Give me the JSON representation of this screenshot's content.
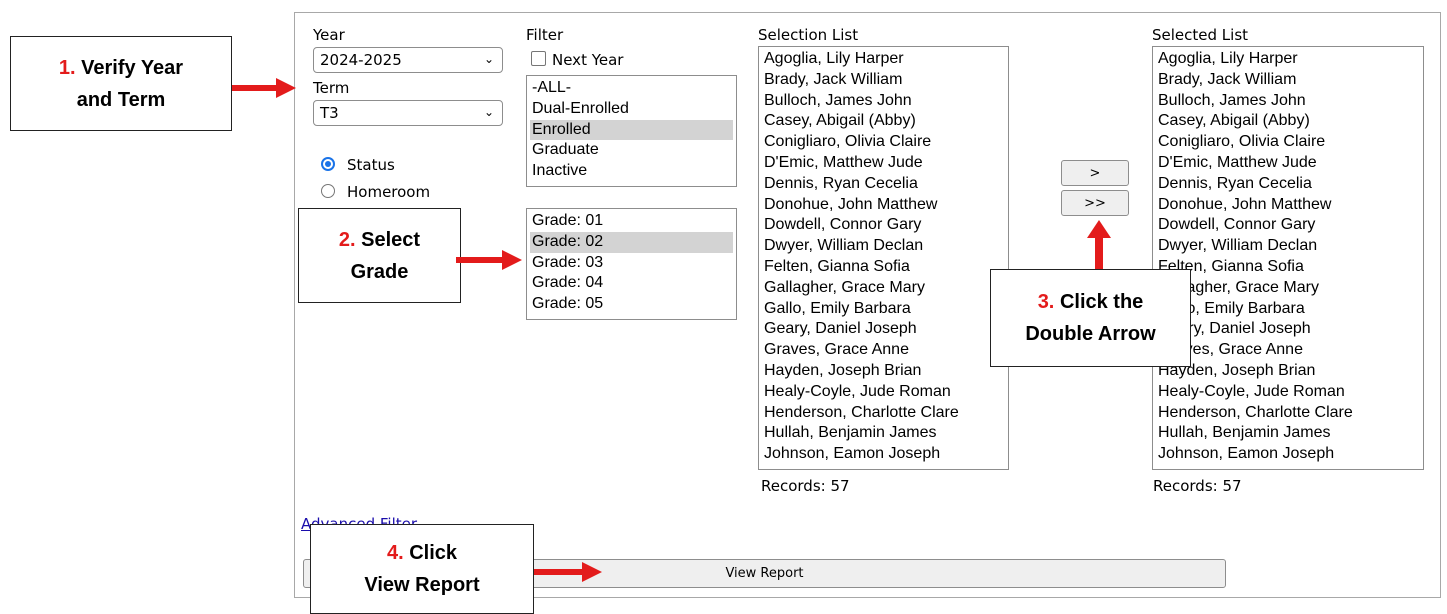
{
  "form": {
    "year_label": "Year",
    "year_value": "2024-2025",
    "term_label": "Term",
    "term_value": "T3",
    "radios": [
      {
        "label": "Status",
        "checked": true
      },
      {
        "label": "Homeroom",
        "checked": false
      }
    ],
    "filter_label": "Filter",
    "next_year_label": "Next Year",
    "status_options": [
      "-ALL-",
      "Dual-Enrolled",
      "Enrolled",
      "Graduate",
      "Inactive"
    ],
    "status_selected": "Enrolled",
    "grade_options": [
      "Grade: 01",
      "Grade: 02",
      "Grade: 03",
      "Grade: 04",
      "Grade: 05"
    ],
    "grade_selected": "Grade: 02",
    "selection_list_label": "Selection List",
    "selected_list_label": "Selected List",
    "students": [
      "Agoglia, Lily Harper",
      "Brady, Jack William",
      "Bulloch, James John",
      "Casey, Abigail (Abby)",
      "Conigliaro, Olivia Claire",
      "D'Emic, Matthew Jude",
      "Dennis, Ryan Cecelia",
      "Donohue, John Matthew",
      "Dowdell, Connor Gary",
      "Dwyer, William Declan",
      "Felten, Gianna Sofia",
      "Gallagher, Grace Mary",
      "Gallo, Emily Barbara",
      "Geary, Daniel Joseph",
      "Graves, Grace Anne",
      "Hayden, Joseph Brian",
      "Healy-Coyle, Jude Roman",
      "Henderson, Charlotte Clare",
      "Hullah, Benjamin James",
      "Johnson, Eamon Joseph"
    ],
    "selection_records": "Records: 57",
    "selected_records": "Records: 57",
    "move_one_label": ">",
    "move_all_label": ">>",
    "advanced_filter_label": "Advanced Filter",
    "view_report_label": "View Report"
  },
  "callouts": {
    "c1_num": "1.",
    "c1_line1": "Verify Year",
    "c1_line2": "and Term",
    "c2_num": "2.",
    "c2_line1": "Select",
    "c2_line2": "Grade",
    "c3_num": "3.",
    "c3_line1": "Click the",
    "c3_line2": "Double Arrow",
    "c4_num": "4.",
    "c4_line1": "Click",
    "c4_line2": "View Report"
  },
  "colors": {
    "callout_number": "#e31b1b",
    "arrow": "#e31b1b",
    "radio_accent": "#1a73e8",
    "selected_row": "#d3d3d3",
    "link": "#1a0dab"
  },
  "icons": [
    "chevron-down-icon",
    "arrow-right-icon",
    "arrow-up-icon"
  ]
}
